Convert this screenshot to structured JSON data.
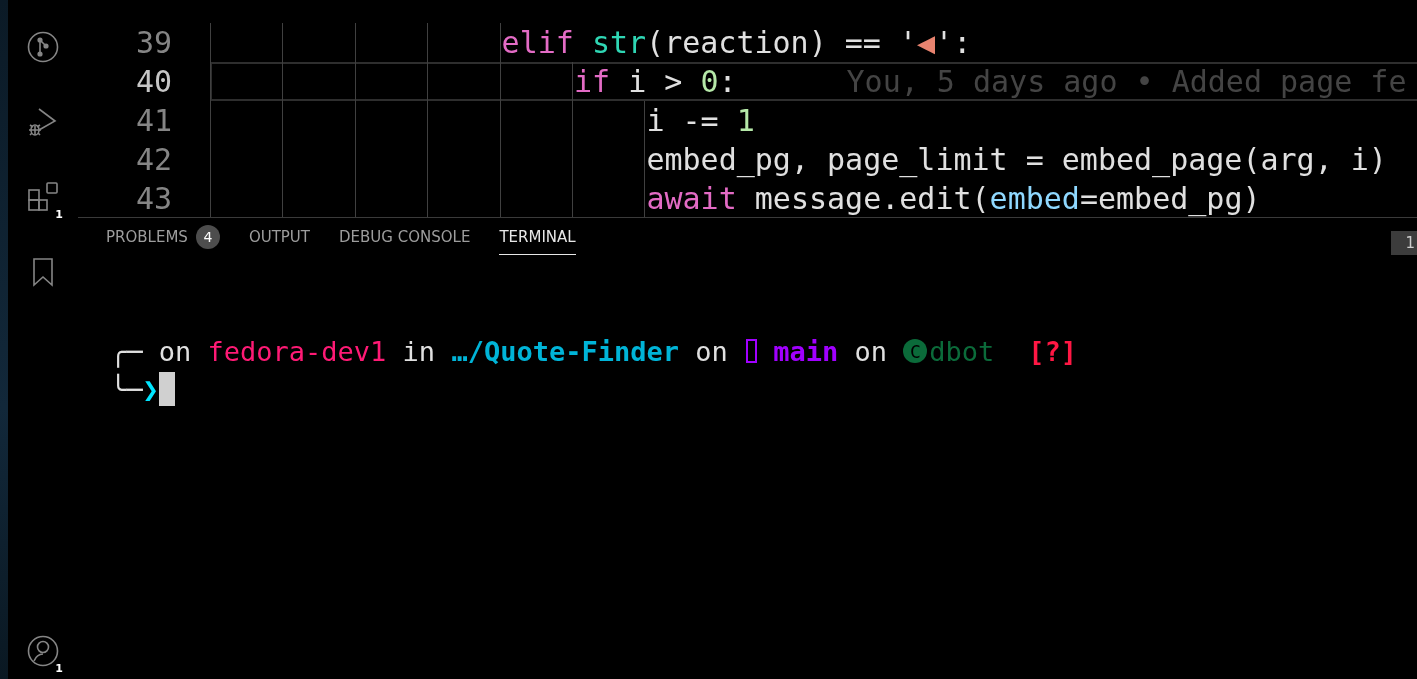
{
  "activity_bar": {
    "top": [
      {
        "kind": "source-control"
      },
      {
        "kind": "run-debug"
      },
      {
        "kind": "extensions",
        "badge": "1"
      },
      {
        "kind": "bookmark"
      }
    ],
    "bottom": [
      {
        "kind": "account",
        "badge": "1"
      }
    ]
  },
  "editor": {
    "lines": [
      {
        "number": "39",
        "current": false,
        "tokens": [
          {
            "kind": "keyword",
            "text": "elif "
          },
          {
            "kind": "function",
            "text": "str"
          },
          {
            "kind": "plain",
            "text": "(reaction) == '"
          },
          {
            "kind": "string",
            "text": "◀"
          },
          {
            "kind": "plain",
            "text": "':"
          }
        ],
        "children": [
          {
            "number": "40",
            "current": true,
            "tokens": [
              {
                "kind": "keyword",
                "text": "if"
              },
              {
                "kind": "plain",
                "text": " i > "
              },
              {
                "kind": "number",
                "text": "0"
              },
              {
                "kind": "plain",
                "text": ":"
              },
              {
                "kind": "blame",
                "text": "You, 5 days ago • Added page fe"
              }
            ],
            "children": [
              {
                "number": "41",
                "current": false,
                "tokens": [
                  {
                    "kind": "plain",
                    "text": "i -= "
                  },
                  {
                    "kind": "number",
                    "text": "1"
                  }
                ]
              },
              {
                "number": "42",
                "current": false,
                "tokens": [
                  {
                    "kind": "plain",
                    "text": "embed_pg, page_limit = embed_page(arg, i)"
                  }
                ]
              },
              {
                "number": "43",
                "current": false,
                "tokens": [
                  {
                    "kind": "keyword",
                    "text": "await"
                  },
                  {
                    "kind": "plain",
                    "text": " message.edit("
                  },
                  {
                    "kind": "param",
                    "text": "embed"
                  },
                  {
                    "kind": "plain",
                    "text": "=embed_pg)"
                  }
                ]
              }
            ]
          }
        ]
      }
    ]
  },
  "panel": {
    "tabs": [
      {
        "label": "PROBLEMS",
        "badge": "4",
        "selected": false
      },
      {
        "label": "OUTPUT",
        "selected": false
      },
      {
        "label": "DEBUG CONSOLE",
        "selected": false
      },
      {
        "label": "TERMINAL",
        "selected": true
      }
    ],
    "corner_badge": "1",
    "terminal": {
      "prompt": [
        {
          "kind": "frame",
          "text": "╭─"
        },
        {
          "kind": "plain",
          "text": " on "
        },
        {
          "kind": "host",
          "text": "fedora-dev1"
        },
        {
          "kind": "plain",
          "text": " in "
        },
        {
          "kind": "dir",
          "text": "…/Quote-Finder"
        },
        {
          "kind": "plain",
          "text": " on "
        },
        {
          "kind": "glyph"
        },
        {
          "kind": "branch",
          "text": " main"
        },
        {
          "kind": "plain",
          "text": " on "
        },
        {
          "kind": "env-icon",
          "text": "C"
        },
        {
          "kind": "env",
          "text": "dbot"
        },
        {
          "kind": "status",
          "text": "[?]"
        }
      ],
      "input_line": [
        {
          "kind": "frame",
          "text": "╰─"
        },
        {
          "kind": "arrow",
          "text": "❯"
        }
      ]
    }
  }
}
